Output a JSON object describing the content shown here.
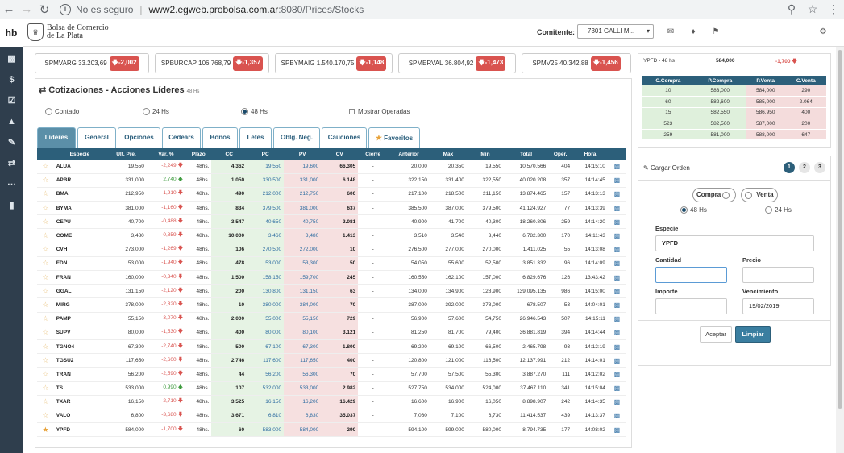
{
  "browser": {
    "not_secure": "No es seguro",
    "host": "www2.egweb.probolsa.com.ar",
    "path": ":8080/Prices/Stocks"
  },
  "app": {
    "short": "hb",
    "logo_line1": "Bolsa de Comercio",
    "logo_line2": "de La Plata",
    "comitente_label": "Comitente:",
    "comitente_value": "7301 GALLI M..."
  },
  "tickers": [
    {
      "name": "SPMVARG",
      "value": "33.203,69",
      "change": "-2,002"
    },
    {
      "name": "SPBURCAP",
      "value": "106.768,79",
      "change": "-1,357"
    },
    {
      "name": "SPBYMAIG",
      "value": "1.540.170,75",
      "change": "-1,148"
    },
    {
      "name": "SPMERVAL",
      "value": "36.804,92",
      "change": "-1,473"
    },
    {
      "name": "SPMV25",
      "value": "40.342,88",
      "change": "-1,456"
    }
  ],
  "panel": {
    "title": "Cotizaciones - Acciones Líderes",
    "title_sub": "48 Hs",
    "radio_contado": "Contado",
    "radio_24": "24 Hs",
    "radio_48": "48 Hs",
    "mostrar": "Mostrar Operadas",
    "tabs": [
      "Líderes",
      "General",
      "Opciones",
      "Cedears",
      "Bonos",
      "Letes",
      "Oblg. Neg.",
      "Cauciones",
      "Favoritos"
    ]
  },
  "columns": [
    "",
    "Especie",
    "Ult. Pre.",
    "Var. %",
    "Plazo",
    "CC",
    "PC",
    "PV",
    "CV",
    "Cierre",
    "Anterior",
    "Max",
    "Min",
    "Total",
    "Oper.",
    "Hora",
    ""
  ],
  "rows": [
    [
      "ALUA",
      "19,550",
      "-2,249",
      "dn",
      "48hs.",
      "4.362",
      "19,550",
      "19,600",
      "66.305",
      "-",
      "20,000",
      "20,350",
      "19,550",
      "10.570.566",
      "404",
      "14:15:10",
      false
    ],
    [
      "APBR",
      "331,000",
      "2,740",
      "up",
      "48hs.",
      "1.050",
      "330,500",
      "331,000",
      "6.148",
      "-",
      "322,150",
      "331,400",
      "322,550",
      "40.020.208",
      "357",
      "14:14:45",
      false
    ],
    [
      "BMA",
      "212,950",
      "-1,910",
      "dn",
      "48hs.",
      "490",
      "212,000",
      "212,750",
      "600",
      "-",
      "217,100",
      "218,500",
      "211,150",
      "13.874.465",
      "157",
      "14:13:13",
      false
    ],
    [
      "BYMA",
      "381,000",
      "-1,160",
      "dn",
      "48hs.",
      "834",
      "379,500",
      "381,000",
      "637",
      "-",
      "385,500",
      "387,000",
      "379,500",
      "41.124.927",
      "77",
      "14:13:39",
      false
    ],
    [
      "CEPU",
      "40,700",
      "-0,488",
      "dn",
      "48hs.",
      "3.547",
      "40,650",
      "40,750",
      "2.081",
      "-",
      "40,900",
      "41,700",
      "40,300",
      "18.260.806",
      "259",
      "14:14:20",
      false
    ],
    [
      "COME",
      "3,480",
      "-0,859",
      "dn",
      "48hs.",
      "10.000",
      "3,460",
      "3,480",
      "1.413",
      "-",
      "3,510",
      "3,540",
      "3,440",
      "6.782.300",
      "170",
      "14:11:43",
      false
    ],
    [
      "CVH",
      "273,000",
      "-1,269",
      "dn",
      "48hs.",
      "106",
      "270,500",
      "272,000",
      "10",
      "-",
      "276,500",
      "277,000",
      "270,000",
      "1.411.025",
      "55",
      "14:13:08",
      false
    ],
    [
      "EDN",
      "53,000",
      "-1,940",
      "dn",
      "48hs.",
      "478",
      "53,000",
      "53,300",
      "50",
      "-",
      "54,050",
      "55,600",
      "52,500",
      "3.851.332",
      "96",
      "14:14:09",
      false
    ],
    [
      "FRAN",
      "160,000",
      "-0,340",
      "dn",
      "48hs.",
      "1.500",
      "158,150",
      "159,700",
      "245",
      "-",
      "160,550",
      "162,100",
      "157,000",
      "6.829.676",
      "126",
      "13:43:42",
      false
    ],
    [
      "GGAL",
      "131,150",
      "-2,120",
      "dn",
      "48hs.",
      "200",
      "130,800",
      "131,150",
      "63",
      "-",
      "134,000",
      "134,900",
      "128,900",
      "139.095.135",
      "986",
      "14:15:00",
      false
    ],
    [
      "MIRG",
      "378,000",
      "-2,320",
      "dn",
      "48hs.",
      "10",
      "380,000",
      "384,000",
      "70",
      "-",
      "387,000",
      "392,000",
      "378,000",
      "678.507",
      "53",
      "14:04:01",
      false
    ],
    [
      "PAMP",
      "55,150",
      "-3,070",
      "dn",
      "48hs.",
      "2.000",
      "55,000",
      "55,150",
      "729",
      "-",
      "56,900",
      "57,600",
      "54,750",
      "26.946.543",
      "507",
      "14:15:11",
      false
    ],
    [
      "SUPV",
      "80,000",
      "-1,530",
      "dn",
      "48hs.",
      "400",
      "80,000",
      "80,100",
      "3.121",
      "-",
      "81,250",
      "81,700",
      "79,400",
      "36.881.819",
      "394",
      "14:14:44",
      false
    ],
    [
      "TGNO4",
      "67,300",
      "-2,740",
      "dn",
      "48hs.",
      "500",
      "67,100",
      "67,300",
      "1.800",
      "-",
      "69,200",
      "69,100",
      "66,500",
      "2.465.798",
      "93",
      "14:12:19",
      false
    ],
    [
      "TGSU2",
      "117,650",
      "-2,600",
      "dn",
      "48hs.",
      "2.746",
      "117,600",
      "117,650",
      "400",
      "-",
      "120,800",
      "121,000",
      "116,500",
      "12.137.991",
      "212",
      "14:14:01",
      false
    ],
    [
      "TRAN",
      "56,200",
      "-2,590",
      "dn",
      "48hs.",
      "44",
      "56,200",
      "56,300",
      "70",
      "-",
      "57,700",
      "57,500",
      "55,300",
      "3.887.270",
      "111",
      "14:12:02",
      false
    ],
    [
      "TS",
      "533,000",
      "0,990",
      "up",
      "48hs.",
      "107",
      "532,000",
      "533,000",
      "2.982",
      "-",
      "527,750",
      "534,000",
      "524,000",
      "37.467.110",
      "341",
      "14:15:04",
      false
    ],
    [
      "TXAR",
      "16,150",
      "-2,710",
      "dn",
      "48hs.",
      "3.525",
      "16,150",
      "16,200",
      "16.429",
      "-",
      "16,600",
      "16,900",
      "16,050",
      "8.898.907",
      "242",
      "14:14:35",
      false
    ],
    [
      "VALO",
      "6,800",
      "-3,680",
      "dn",
      "48hs.",
      "3.671",
      "6,810",
      "6,830",
      "35.037",
      "-",
      "7,060",
      "7,100",
      "6,730",
      "11.414.537",
      "439",
      "14:13:37",
      false
    ],
    [
      "YPFD",
      "584,000",
      "-1,700",
      "dn",
      "48hs.",
      "60",
      "583,000",
      "584,000",
      "290",
      "-",
      "594,100",
      "599,000",
      "580,000",
      "8.794.735",
      "177",
      "14:08:02",
      true
    ]
  ],
  "book": {
    "symbol": "YPFD - 48 hs",
    "price": "584,000",
    "change": "-1,700",
    "headers": [
      "C.Compra",
      "P.Compra",
      "P.Venta",
      "C.Venta"
    ],
    "rows": [
      [
        "10",
        "583,000",
        "584,000",
        "290"
      ],
      [
        "60",
        "582,600",
        "585,000",
        "2.064"
      ],
      [
        "15",
        "582,550",
        "586,950",
        "400"
      ],
      [
        "523",
        "582,500",
        "587,000",
        "200"
      ],
      [
        "259",
        "581,000",
        "588,000",
        "647"
      ]
    ]
  },
  "orden": {
    "title": "Cargar Orden",
    "steps": [
      "1",
      "2",
      "3"
    ],
    "compra": "Compra",
    "venta": "Venta",
    "r48": "48 Hs",
    "r24": "24 Hs",
    "especie_label": "Especie",
    "especie_value": "YPFD",
    "cantidad_label": "Cantidad",
    "precio_label": "Precio",
    "importe_label": "Importe",
    "venc_label": "Vencimiento",
    "venc_value": "19/02/2019",
    "aceptar": "Aceptar",
    "limpiar": "Limpiar"
  },
  "colors": {
    "header": "#2c5f7a",
    "down": "#d9534f",
    "up": "#3c9a3c",
    "sidebar": "#2f3e4d"
  }
}
